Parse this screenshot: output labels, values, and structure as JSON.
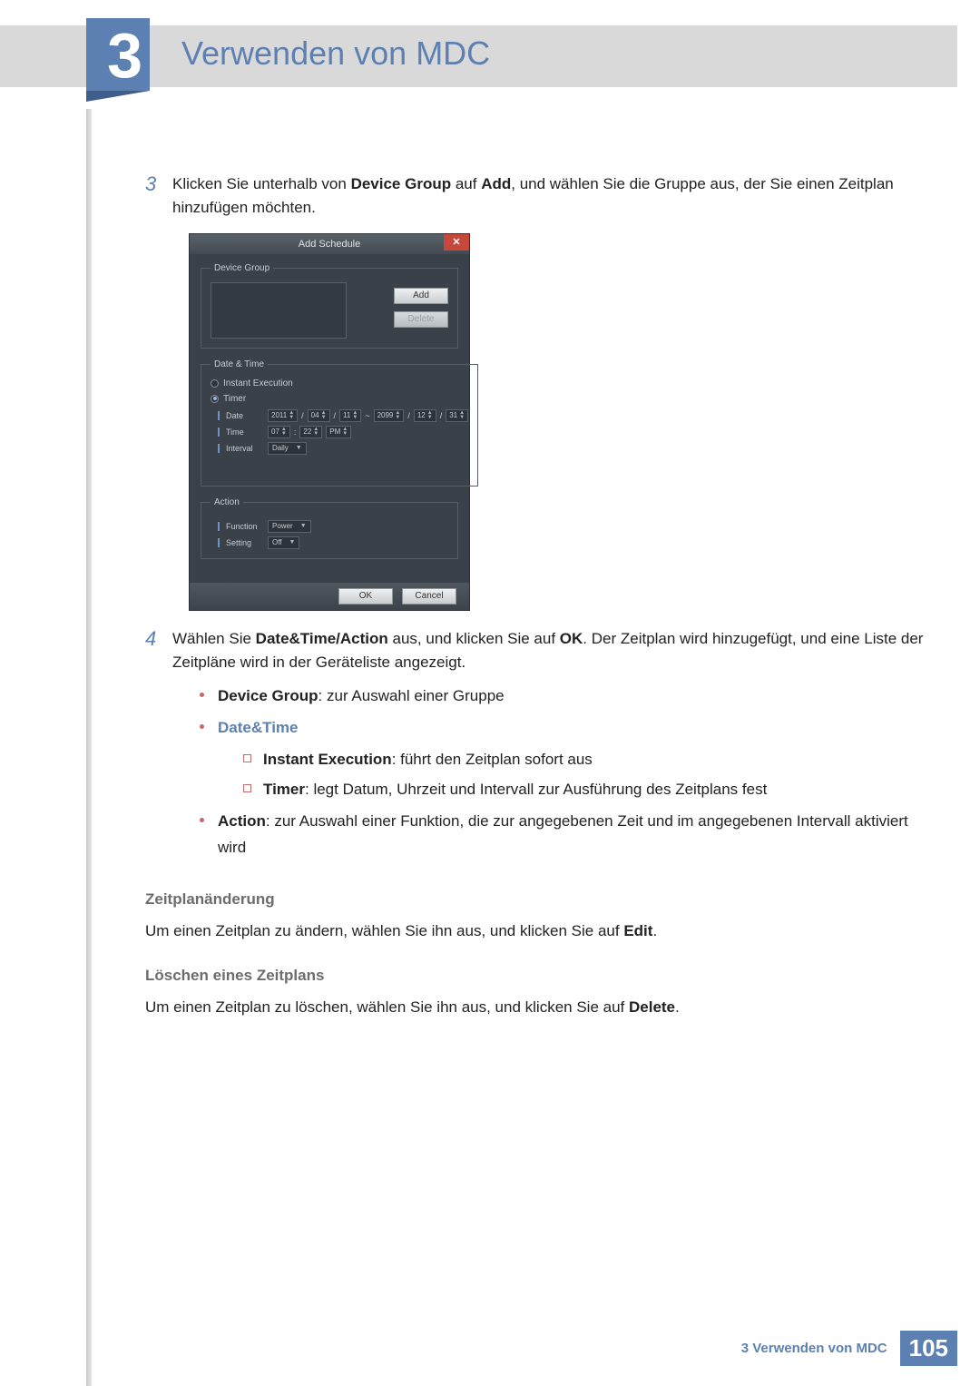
{
  "chapter": {
    "number": "3",
    "title": "Verwenden von MDC"
  },
  "steps": {
    "s3": {
      "num": "3",
      "pre": "Klicken Sie unterhalb von ",
      "b1": "Device Group",
      "mid1": " auf ",
      "b2": "Add",
      "post": ", und wählen Sie die Gruppe aus, der Sie einen Zeitplan hinzufügen möchten."
    },
    "s4": {
      "num": "4",
      "pre": "Wählen Sie ",
      "b1": "Date&Time/Action",
      "mid1": " aus, und klicken Sie auf ",
      "b2": "OK",
      "post": ". Der Zeitplan wird hinzugefügt, und eine Liste der Zeitpläne wird in der Geräteliste angezeigt."
    }
  },
  "dialog": {
    "title": "Add Schedule",
    "device_group_legend": "Device Group",
    "add": "Add",
    "delete": "Delete",
    "datetime_legend": "Date & Time",
    "instant": "Instant Execution",
    "timer": "Timer",
    "date_label": "Date",
    "date_y1": "2011",
    "date_m1": "04",
    "date_d1": "11",
    "date_tilde": "~",
    "date_y2": "2099",
    "date_m2": "12",
    "date_d2": "31",
    "time_label": "Time",
    "time_h": "07",
    "time_m": "22",
    "time_ap": "PM",
    "interval_label": "Interval",
    "interval_val": "Daily",
    "action_legend": "Action",
    "function_label": "Function",
    "function_val": "Power",
    "setting_label": "Setting",
    "setting_val": "Off",
    "ok": "OK",
    "cancel": "Cancel",
    "slash": "/",
    "spin_arrows": "▲\n▼"
  },
  "bullets": {
    "device_group_b": "Device Group",
    "device_group_t": ": zur Auswahl einer Gruppe",
    "datetime": "Date&Time",
    "instant_b": "Instant Execution",
    "instant_t": ": führt den Zeitplan sofort aus",
    "timer_b": "Timer",
    "timer_t": ": legt Datum, Uhrzeit und Intervall zur Ausführung des Zeitplans fest",
    "action_b": "Action",
    "action_t": ": zur Auswahl einer Funktion, die zur angegebenen Zeit und im angegebenen Intervall aktiviert wird"
  },
  "sections": {
    "edit_head": "Zeitplanänderung",
    "edit_pre": "Um einen Zeitplan zu ändern, wählen Sie ihn aus, und klicken Sie auf ",
    "edit_b": "Edit",
    "edit_post": ".",
    "del_head": "Löschen eines Zeitplans",
    "del_pre": "Um einen Zeitplan zu löschen, wählen Sie ihn aus, und klicken Sie auf ",
    "del_b": "Delete",
    "del_post": "."
  },
  "footer": {
    "label": "3 Verwenden von MDC",
    "page": "105"
  }
}
